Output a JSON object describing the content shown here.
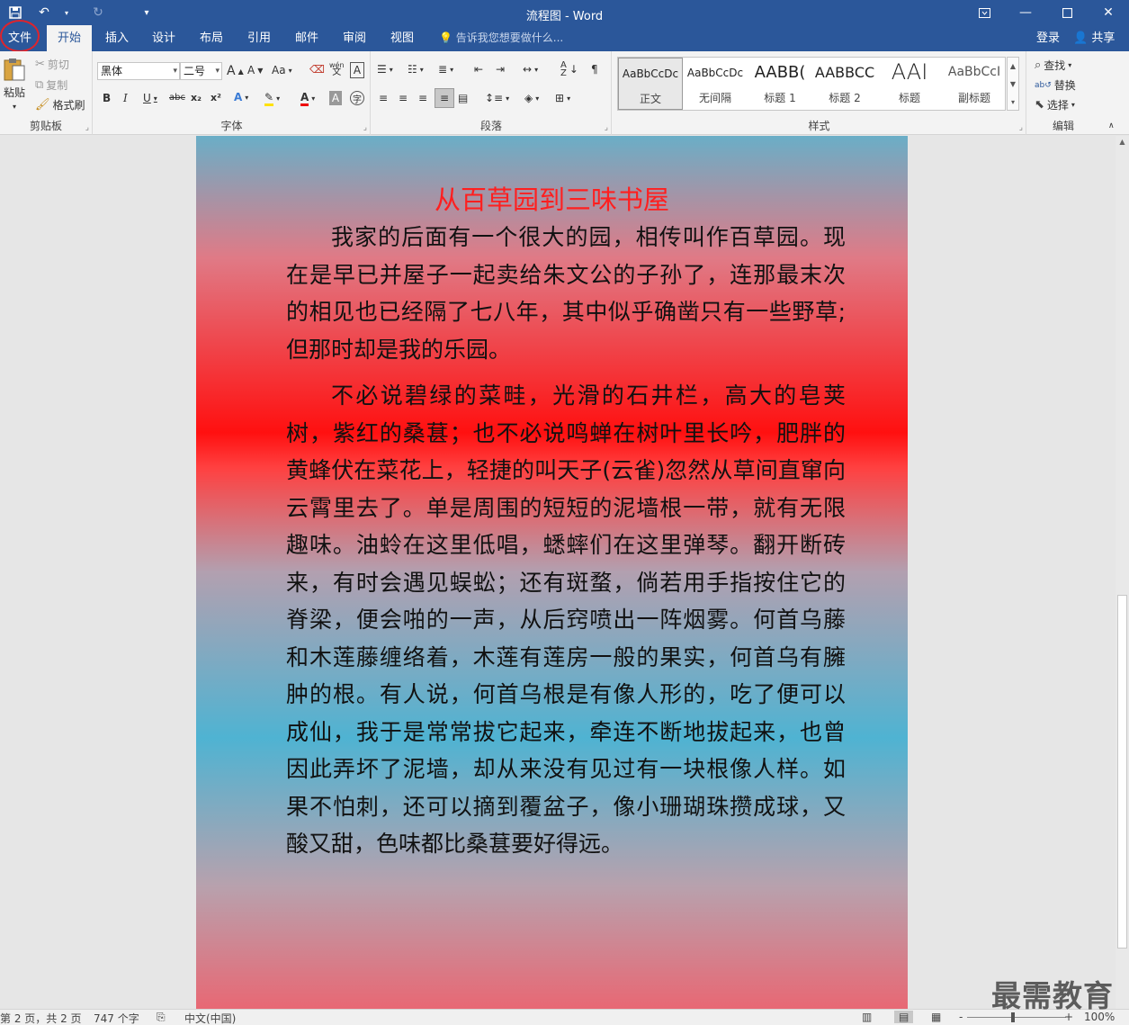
{
  "titlebar": {
    "title": "流程图 - Word",
    "icons": [
      "save-icon",
      "undo-icon",
      "redo-icon",
      "customize-qat-icon"
    ]
  },
  "tabs": {
    "file": "文件",
    "home": "开始",
    "insert": "插入",
    "design": "设计",
    "layout": "布局",
    "references": "引用",
    "mailings": "邮件",
    "review": "审阅",
    "view": "视图",
    "tell_me": "告诉我您想要做什么...",
    "login": "登录",
    "share": "共享"
  },
  "ribbon": {
    "clipboard": {
      "label": "剪贴板",
      "paste": "粘贴",
      "cut": "剪切",
      "copy": "复制",
      "format_painter": "格式刷"
    },
    "font": {
      "label": "字体",
      "font_name": "黑体",
      "font_size": "二号",
      "aa_label": "Aa",
      "grow": "A",
      "shrink": "A",
      "bold": "B",
      "italic": "I",
      "underline": "U",
      "strike": "abc",
      "subscript": "x₂",
      "superscript": "x²",
      "font_color": "A",
      "char_shading": "A",
      "wen": "wén"
    },
    "paragraph": {
      "label": "段落"
    },
    "styles": {
      "label": "样式",
      "items": [
        {
          "sample": "AaBbCcDc",
          "name": "正文"
        },
        {
          "sample": "AaBbCcDc",
          "name": "无间隔"
        },
        {
          "sample": "AABB(",
          "name": "标题 1"
        },
        {
          "sample": "AABBCC",
          "name": "标题 2"
        },
        {
          "sample": "AAI",
          "name": "标题"
        },
        {
          "sample": "AaBbCcI",
          "name": "副标题"
        }
      ]
    },
    "editing": {
      "label": "编辑",
      "find": "查找",
      "replace": "替换",
      "select": "选择"
    }
  },
  "document": {
    "title": "从百草园到三味书屋",
    "paragraph1": "我家的后面有一个很大的园，相传叫作百草园。现在是早已并屋子一起卖给朱文公的子孙了，连那最末次的相见也已经隔了七八年，其中似乎确凿只有一些野草;但那时却是我的乐园。",
    "paragraph2": "不必说碧绿的菜畦，光滑的石井栏，高大的皂荚树，紫红的桑葚；也不必说鸣蝉在树叶里长吟，肥胖的黄蜂伏在菜花上，轻捷的叫天子(云雀)忽然从草间直窜向云霄里去了。单是周围的短短的泥墙根一带，就有无限趣味。油蛉在这里低唱，蟋蟀们在这里弹琴。翻开断砖来，有时会遇见蜈蚣；还有斑蝥，倘若用手指按住它的脊梁，便会啪的一声，从后窍喷出一阵烟雾。何首乌藤和木莲藤缠络着，木莲有莲房一般的果实，何首乌有臃肿的根。有人说，何首乌根是有像人形的，吃了便可以成仙，我于是常常拔它起来，牵连不断地拔起来，也曾因此弄坏了泥墙，却从来没有见过有一块根像人样。如果不怕刺，还可以摘到覆盆子，像小珊瑚珠攒成球，又酸又甜，色味都比桑葚要好得远。"
  },
  "statusbar": {
    "page": "第 2 页，共 2 页",
    "words": "747 个字",
    "language": "中文(中国)",
    "zoom": "100%",
    "zoom_minus": "-",
    "zoom_plus": "+"
  },
  "watermark": "最需教育",
  "colors": {
    "word_blue": "#2b579a",
    "title_red": "#ff1f1f",
    "highlight_circle": "#e0232b"
  }
}
